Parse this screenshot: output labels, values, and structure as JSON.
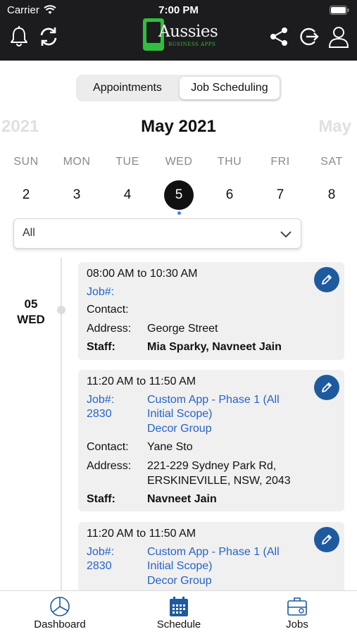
{
  "status_bar": {
    "carrier": "Carrier",
    "time": "7:00 PM"
  },
  "header": {
    "logo_text": "Aussies",
    "logo_tagline": "BUSINESS APPS",
    "icons": [
      "bell-icon",
      "refresh-icon",
      "share-icon",
      "logout-icon",
      "profile-icon"
    ]
  },
  "segment": {
    "left_label": "Appointments",
    "right_label": "Job Scheduling",
    "selected": "Job Scheduling"
  },
  "calendar": {
    "prev_year": "2021",
    "title": "May 2021",
    "next_year": "May",
    "days": [
      {
        "name": "SUN",
        "num": "2"
      },
      {
        "name": "MON",
        "num": "3"
      },
      {
        "name": "TUE",
        "num": "4"
      },
      {
        "name": "WED",
        "num": "5"
      },
      {
        "name": "THU",
        "num": "6"
      },
      {
        "name": "FRI",
        "num": "7"
      },
      {
        "name": "SAT",
        "num": "8"
      }
    ],
    "selected_day": "5"
  },
  "filter": {
    "value": "All"
  },
  "timeline": {
    "date_day": "05",
    "date_weekday": "WED"
  },
  "cards": [
    {
      "time": "08:00 AM to 10:30 AM",
      "job_label": "Job#:",
      "job_number": "",
      "job_title": [],
      "contact_label": "Contact:",
      "contact": "",
      "address_label": "Address:",
      "address": [
        "George Street"
      ],
      "staff_label": "Staff:",
      "staff": "Mia Sparky, Navneet Jain"
    },
    {
      "time": "11:20 AM to 11:50 AM",
      "job_label": "Job#:",
      "job_number": "2830",
      "job_title": [
        "Custom App - Phase 1 (All",
        "Initial Scope)",
        "Decor Group"
      ],
      "contact_label": "Contact:",
      "contact": "Yane Sto",
      "address_label": "Address:",
      "address": [
        "221-229 Sydney Park Rd,",
        "ERSKINEVILLE, NSW, 2043"
      ],
      "staff_label": "Staff:",
      "staff": "Navneet Jain"
    },
    {
      "time": "11:20 AM to 11:50 AM",
      "job_label": "Job#:",
      "job_number": "2830",
      "job_title": [
        "Custom App - Phase 1 (All",
        "Initial Scope)",
        "Decor Group"
      ]
    }
  ],
  "tabbar": {
    "tabs": [
      {
        "label": "Dashboard",
        "icon": "dashboard-icon"
      },
      {
        "label": "Schedule",
        "icon": "calendar-icon",
        "active": true
      },
      {
        "label": "Jobs",
        "icon": "briefcase-icon"
      }
    ]
  },
  "colors": {
    "header_bg": "#1c1c1e",
    "accent_blue": "#2563c9",
    "edit_button": "#1e5b9e",
    "brand_green": "#2fbf3c",
    "schedule_icon": "#1e5b9e"
  }
}
